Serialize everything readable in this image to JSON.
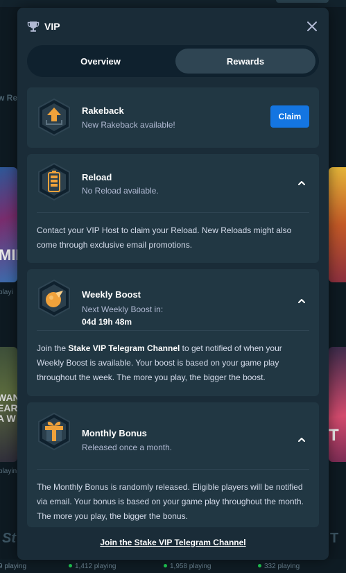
{
  "background": {
    "section_text_left": "w Re",
    "playing_left": "playi",
    "playing_left_2": "playin",
    "logo_text": "St",
    "logo_text_right": "T",
    "bottom_stats": [
      {
        "label": "9 playing"
      },
      {
        "label": "1,412 playing"
      },
      {
        "label": "1,958 playing"
      },
      {
        "label": "332 playing"
      }
    ],
    "card_text_left_1": "MIN",
    "card_text_left_2": "WAN\nEAR\nA W",
    "card_text_right": "T"
  },
  "modal": {
    "title": "VIP",
    "close_icon": "close-icon",
    "tabs": [
      {
        "label": "Overview",
        "active": false
      },
      {
        "label": "Rewards",
        "active": true
      }
    ],
    "rakeback": {
      "title": "Rakeback",
      "subtitle": "New Rakeback available!",
      "claim_label": "Claim"
    },
    "reload": {
      "title": "Reload",
      "subtitle": "No Reload available.",
      "body": "Contact your VIP Host to claim your Reload. New Reloads might also come through exclusive email promotions."
    },
    "weekly_boost": {
      "title": "Weekly Boost",
      "subtitle": "Next Weekly Boost in:",
      "countdown": "04d 19h 48m",
      "body_prefix": "Join the ",
      "body_link": "Stake VIP Telegram Channel",
      "body_suffix": " to get notified of when your Weekly Boost is available. Your boost is based on your game play throughout the week. The more you play, the bigger the boost."
    },
    "monthly_bonus": {
      "title": "Monthly Bonus",
      "subtitle": "Released once a month.",
      "body": "The Monthly Bonus is randomly released. Eligible players will be notified via email. Your bonus is based on your game play throughout the month. The more you play, the bigger the bonus."
    },
    "footer_link": "Join the Stake VIP Telegram Channel"
  },
  "colors": {
    "modal_bg": "#1a2c38",
    "card_bg": "#213743",
    "active_tab": "#2f4553",
    "claim_button": "#1475e1",
    "badge_orange": "#f0a23b"
  }
}
